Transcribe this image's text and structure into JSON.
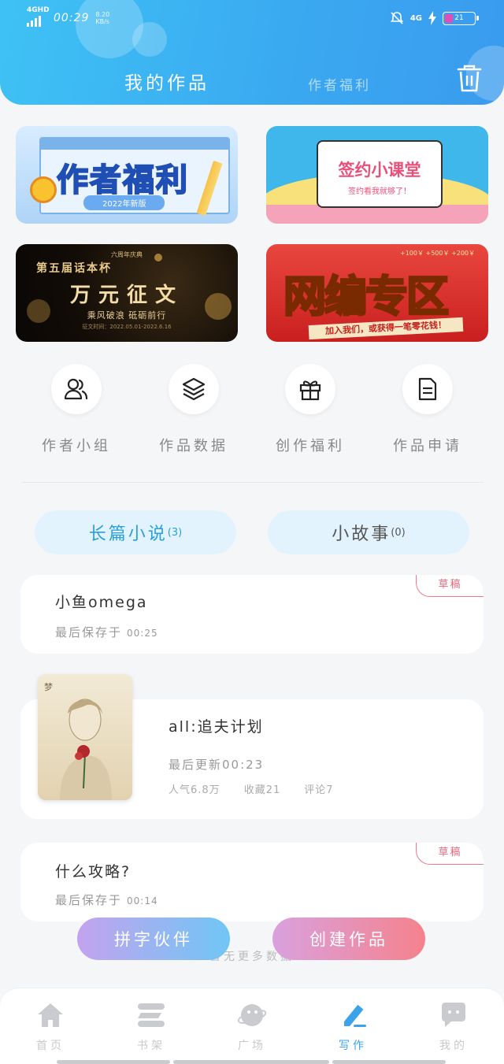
{
  "status_bar": {
    "network": "4GHD",
    "time": "00:29",
    "speed_value": "8.20",
    "speed_unit": "KB/s",
    "network_right": "4G",
    "battery": "21"
  },
  "header": {
    "tab_active": "我的作品",
    "tab_inactive": "作者福利"
  },
  "banners": [
    {
      "title": "作者福利",
      "subtitle": "2022年新版"
    },
    {
      "title": "签约小课堂",
      "subtitle": "签约看我就够了！"
    },
    {
      "series": "第五届话本杯",
      "title": "万元征文",
      "subtitle": "乘风破浪 砥砺前行",
      "top_text": "六周年庆典",
      "date_text": "征文时间：2022.05.01-2022.6.16"
    },
    {
      "title": "网编专区",
      "strip": "加入我们，或获得一笔零花钱！",
      "coins": "+100￥ +500￥ +200￥"
    }
  ],
  "quick_actions": [
    {
      "label": "作者小组",
      "icon": "users-icon"
    },
    {
      "label": "作品数据",
      "icon": "layers-icon"
    },
    {
      "label": "创作福利",
      "icon": "gift-icon"
    },
    {
      "label": "作品申请",
      "icon": "document-icon"
    }
  ],
  "type_tabs": [
    {
      "label": "长篇小说",
      "count": "(3)"
    },
    {
      "label": "小故事",
      "count": "(0)"
    }
  ],
  "works": [
    {
      "title": "小鱼omega",
      "meta_label": "最后保存于",
      "meta_time": "00:25",
      "tag": "草稿"
    },
    {
      "title": "all:追夫计划",
      "updated": "最后更新00:23",
      "popularity": "人气6.8万",
      "favorites": "收藏21",
      "comments": "评论7",
      "cover_text": "梦",
      "cover_icon": "novel-cover-image"
    },
    {
      "title": "什么攻略?",
      "meta_label": "最后保存于",
      "meta_time": "00:14",
      "tag": "草稿"
    }
  ],
  "no_more": "暂无更多数据",
  "float_buttons": [
    {
      "label": "拼字伙伴"
    },
    {
      "label": "创建作品"
    }
  ],
  "bottom_nav": [
    {
      "label": "首页",
      "icon": "home-icon"
    },
    {
      "label": "书架",
      "icon": "bookshelf-icon"
    },
    {
      "label": "广场",
      "icon": "planet-icon"
    },
    {
      "label": "写作",
      "icon": "pen-icon"
    },
    {
      "label": "我的",
      "icon": "chat-bubble-icon"
    }
  ],
  "colors": {
    "accent": "#3aa3ea",
    "header_start": "#3ec2f5",
    "draft_tag": "#e86a7c"
  }
}
